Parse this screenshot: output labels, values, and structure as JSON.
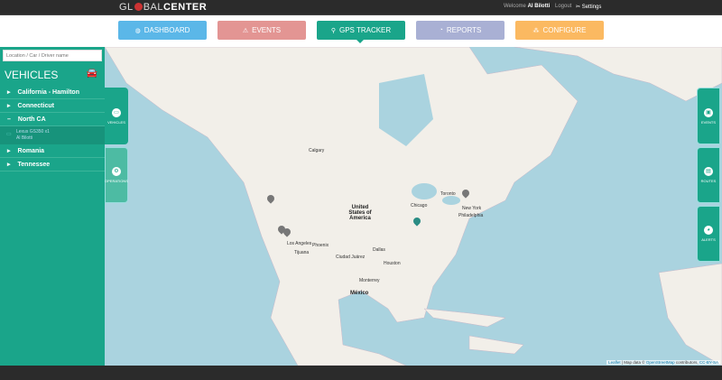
{
  "topbar": {
    "logo_prefix": "GL",
    "logo_mid": "BAL",
    "logo_bold": "CENTER",
    "welcome": "Welcome",
    "user": "Al Bilotti",
    "logout": "Logout",
    "settings": "Settings"
  },
  "nav": [
    {
      "label": "DASHBOARD",
      "icon": "globe-icon",
      "color": "#4ab0e6"
    },
    {
      "label": "EVENTS",
      "icon": "warning-icon",
      "color": "#e08a88"
    },
    {
      "label": "GPS TRACKER",
      "icon": "pin-icon",
      "color": "#1aa58a",
      "active": true
    },
    {
      "label": "REPORTS",
      "icon": "chart-icon",
      "color": "#a0a8d0"
    },
    {
      "label": "CONFIGURE",
      "icon": "sitemap-icon",
      "color": "#fbb251"
    }
  ],
  "sidebar": {
    "search_placeholder": "Location / Car / Driver name",
    "title": "VEHICLES",
    "items": [
      {
        "label": "California - Hamilton"
      },
      {
        "label": "Connecticut"
      },
      {
        "label": "North CA",
        "expanded": true
      },
      {
        "label": "Romania"
      },
      {
        "label": "Tennessee"
      }
    ],
    "vehicle": {
      "model": "Lexus GS350 x1",
      "driver": "Al Bilotti"
    }
  },
  "left_tabs": [
    {
      "label": "VEHICLES"
    },
    {
      "label": "OPERATIONS"
    }
  ],
  "right_tabs": [
    {
      "label": "EVENTS"
    },
    {
      "label": "ROUTES"
    },
    {
      "label": "ALERTS"
    }
  ],
  "map": {
    "labels": {
      "calgary": "Calgary",
      "usa": "United States of America",
      "chicago": "Chicago",
      "toronto": "Toronto",
      "newyork": "New York",
      "philadelphia": "Philadelphia",
      "la": "Los Angeles",
      "phoenix": "Phoenix",
      "tijuana": "Tijuana",
      "dallas": "Dallas",
      "juarez": "Ciudad Juárez",
      "houston": "Houston",
      "monterrey": "Monterrey",
      "mexico": "México"
    },
    "attribution": {
      "leaflet": "Leaflet",
      "text": " | Map data © ",
      "osm": "OpenStreetMap",
      "contrib": " contributors, ",
      "license": "CC-BY-SA"
    }
  }
}
